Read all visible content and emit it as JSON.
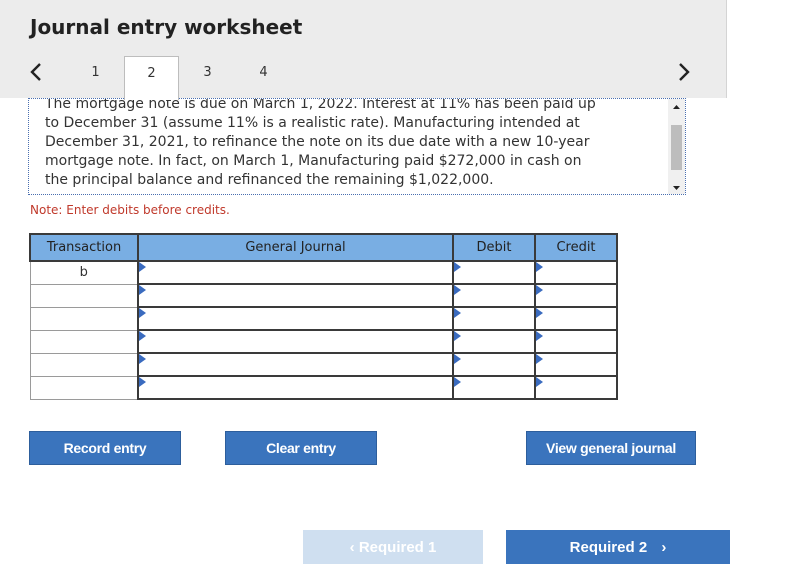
{
  "header": {
    "title": "Journal entry worksheet"
  },
  "tabs": [
    "1",
    "2",
    "3",
    "4"
  ],
  "active_tab": "2",
  "instructions": {
    "text": "The mortgage note is due on March 1, 2022. Interest at 11% has been paid up\nto December 31 (assume 11% is a realistic rate). Manufacturing intended at\nDecember 31, 2021, to refinance the note on its due date with a new 10-year\nmortgage note. In fact, on March 1, Manufacturing paid $272,000 in cash on\nthe principal balance and refinanced the remaining $1,022,000."
  },
  "note": "Note: Enter debits before credits.",
  "table": {
    "headers": {
      "transaction": "Transaction",
      "general_journal": "General Journal",
      "debit": "Debit",
      "credit": "Credit"
    },
    "rows": [
      {
        "transaction": "b",
        "account": "",
        "debit": "",
        "credit": ""
      },
      {
        "transaction": "",
        "account": "",
        "debit": "",
        "credit": ""
      },
      {
        "transaction": "",
        "account": "",
        "debit": "",
        "credit": ""
      },
      {
        "transaction": "",
        "account": "",
        "debit": "",
        "credit": ""
      },
      {
        "transaction": "",
        "account": "",
        "debit": "",
        "credit": ""
      },
      {
        "transaction": "",
        "account": "",
        "debit": "",
        "credit": ""
      }
    ]
  },
  "buttons": {
    "record": "Record entry",
    "clear": "Clear entry",
    "view": "View general journal"
  },
  "footer": {
    "prev_label": "Required 1",
    "next_label": "Required 2"
  },
  "colors": {
    "header_blue": "#79aee3",
    "button_blue": "#3a74bd",
    "note_red": "#c0392b",
    "disabled_blue": "#cfdff0"
  }
}
